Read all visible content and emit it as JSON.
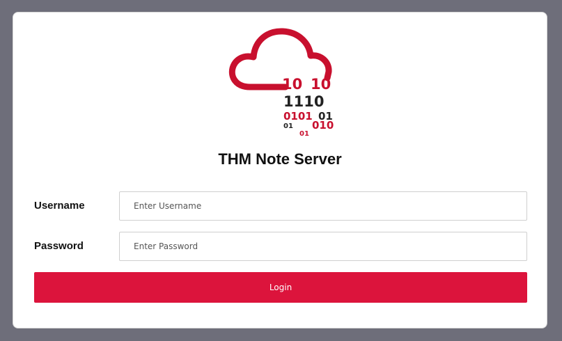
{
  "app": {
    "title": "THM Note Server",
    "logo_binary": {
      "row1_left": "10",
      "row1_right": "10",
      "row2": "1110",
      "row3_left": "0101",
      "row3_right": "01",
      "row4_left": "01",
      "row4_right": "010",
      "row5": "01"
    }
  },
  "form": {
    "username_label": "Username",
    "username_placeholder": "Enter Username",
    "username_value": "",
    "password_label": "Password",
    "password_placeholder": "Enter Password",
    "password_value": "",
    "login_label": "Login"
  },
  "colors": {
    "background": "#6e6e7a",
    "accent": "#dc143c",
    "logo_red": "#c8102e",
    "logo_dark": "#222222"
  },
  "icons": {
    "logo": "cloud-binary-logo"
  }
}
